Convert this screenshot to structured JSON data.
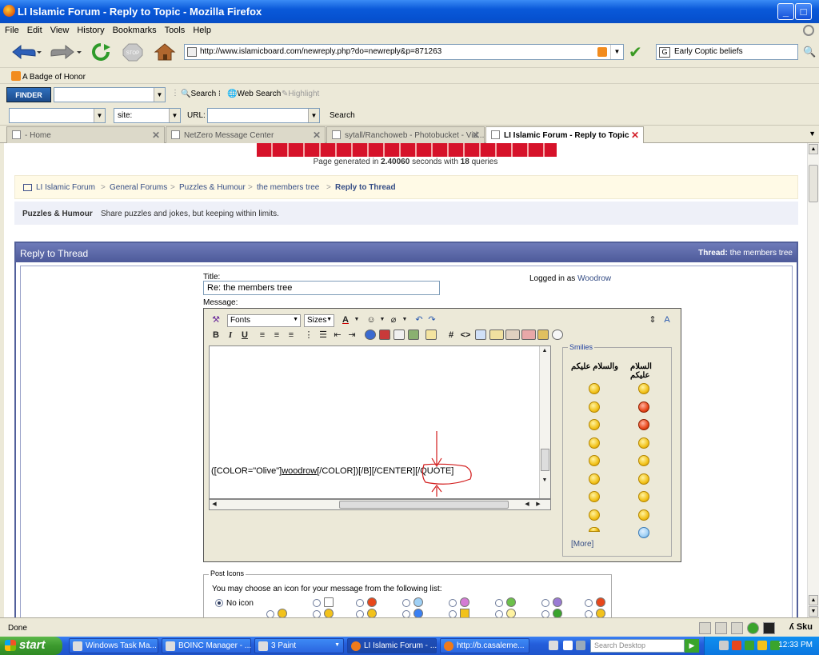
{
  "window": {
    "title": "LI Islamic Forum - Reply to Topic - Mozilla Firefox",
    "min": "_",
    "max": "□",
    "close": "✕"
  },
  "menu": [
    "File",
    "Edit",
    "View",
    "History",
    "Bookmarks",
    "Tools",
    "Help"
  ],
  "nav": {
    "url": "http://www.islamicboard.com/newreply.php?do=newreply&p=871263",
    "search_value": "Early Coptic beliefs"
  },
  "bookmarks": [
    "A Badge of Honor"
  ],
  "finder": {
    "logo": "FINDER",
    "search_label": "Search",
    "web_search_label": "Web Search",
    "highlight_label": "Highlight",
    "site_value": "site:",
    "url_label": "URL:",
    "search_button": "Search"
  },
  "tabs": [
    {
      "label": "- Home",
      "active": false
    },
    {
      "label": "NetZero Message Center",
      "active": false
    },
    {
      "label": "sytall/Ranchoweb - Photobucket - Vid...",
      "active": false
    },
    {
      "label": "LI Islamic Forum - Reply to Topic",
      "active": true
    }
  ],
  "page": {
    "generated_prefix": "Page generated in ",
    "generated_time": "2.40060",
    "generated_mid": " seconds with ",
    "generated_queries": "18",
    "generated_suffix": " queries",
    "breadcrumbs": [
      "LI Islamic Forum",
      "General Forums",
      "Puzzles & Humour",
      "the members tree"
    ],
    "crumb_current": "Reply to Thread",
    "forum_name": "Puzzles & Humour",
    "forum_desc": "Share puzzles and jokes, but keeping within limits.",
    "reply_header": "Reply to Thread",
    "thread_label": "Thread:",
    "thread_name": "the members tree",
    "title_label": "Title:",
    "title_value": "Re: the members tree",
    "logged_in_prefix": "Logged in as",
    "logged_in_user": "Woodrow",
    "message_label": "Message:"
  },
  "editor": {
    "fonts_value": "Fonts",
    "sizes_value": "Sizes",
    "bold": "B",
    "italic": "I",
    "underline": "U",
    "hash": "#",
    "code": "<>",
    "message_part1": "([COLOR=\"Olive\"]",
    "message_word": "woodrow",
    "message_part2": "[/COLOR])[/B][/CENTER][/QUOTE]"
  },
  "smilies": {
    "legend": "Smilies",
    "col1_header": "والسلام عليكم",
    "col2_header": "السلام عليكم",
    "more": "[More]"
  },
  "post_icons": {
    "legend": "Post Icons",
    "desc": "You may choose an icon for your message from the following list:",
    "no_icon": "No icon"
  },
  "status": {
    "text": "Done",
    "right": "ʎ Sku"
  },
  "taskbar": {
    "start": "start",
    "tasks": [
      "Windows Task Ma...",
      "BOINC Manager - ...",
      "3 Paint",
      "LI Islamic Forum - ...",
      "http://b.casaleme..."
    ],
    "desk_search_placeholder": "Search Desktop",
    "clock": "12:33 PM"
  }
}
